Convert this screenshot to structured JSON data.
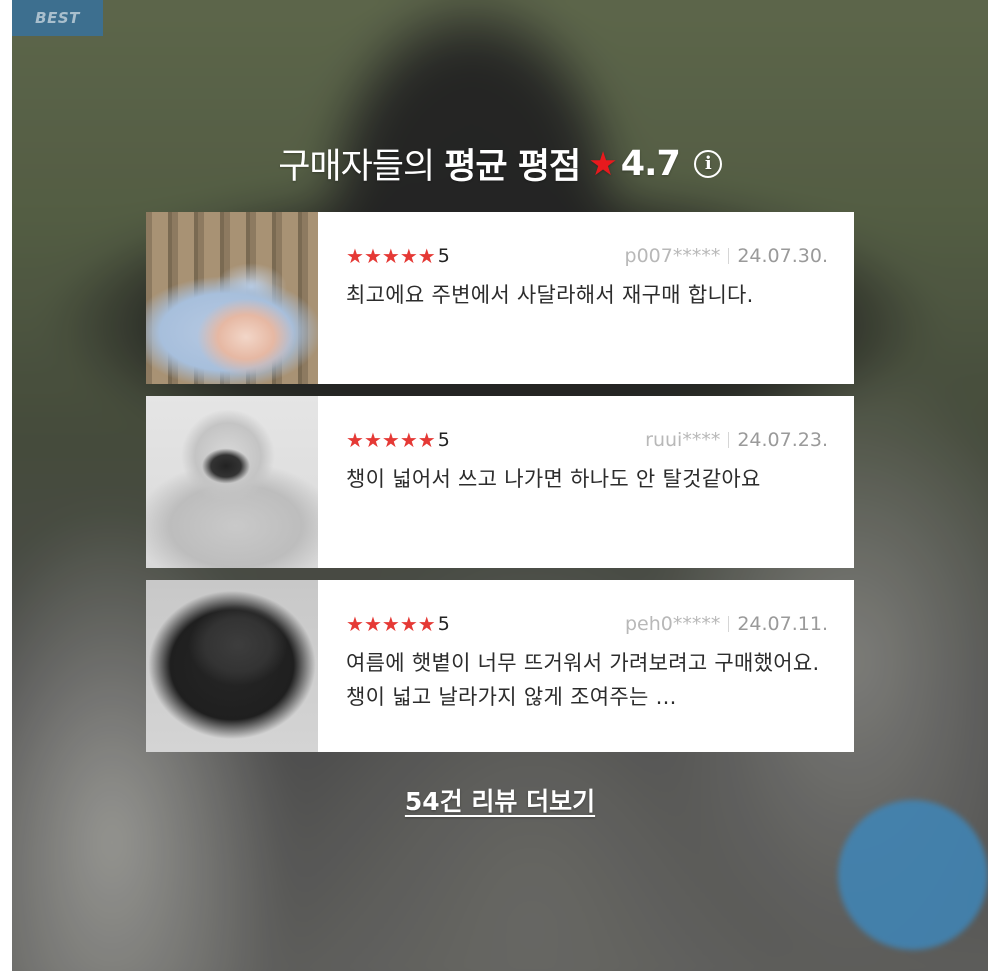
{
  "badge": {
    "label": "BEST"
  },
  "headline": {
    "prefix": "구매자들의",
    "bold": "평균 평점",
    "star": "★",
    "score": "4.7",
    "info_icon": "i"
  },
  "reviews": [
    {
      "rating": "5",
      "author": "p007*****",
      "date": "24.07.30.",
      "text": "최고에요 주변에서 사달라해서 재구매 합니다."
    },
    {
      "rating": "5",
      "author": "ruui****",
      "date": "24.07.23.",
      "text": "챙이 넓어서 쓰고 나가면 하나도 안 탈것같아요"
    },
    {
      "rating": "5",
      "author": "peh0*****",
      "date": "24.07.11.",
      "text": "여름에 햇볕이 너무 뜨거워서 가려보려고 구매했어요.챙이 넓고 날라가지 않게 조여주는 …"
    }
  ],
  "more_link": {
    "label": "54건 리뷰 더보기"
  },
  "colors": {
    "star": "#e53935",
    "badge_bg": "#3d6f8f",
    "fab": "#3f86b8"
  },
  "icons": {
    "star": "star-icon",
    "info": "info-icon"
  }
}
